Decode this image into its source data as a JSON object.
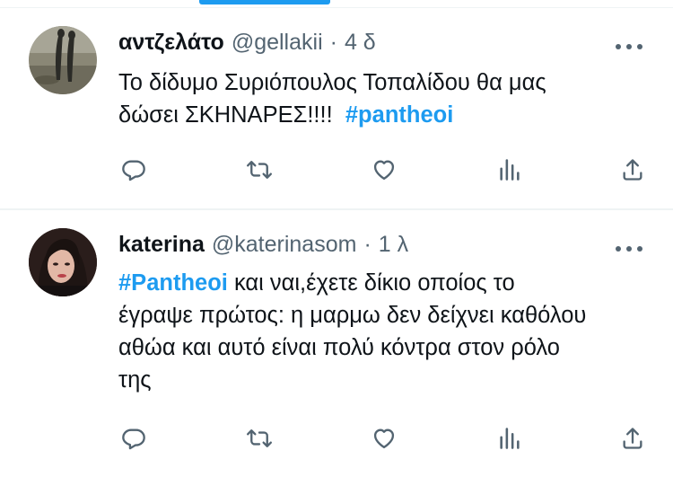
{
  "colors": {
    "accent": "#1d9bf0",
    "text": "#0f1419",
    "muted": "#536471",
    "divider": "#eff3f4"
  },
  "tweets": [
    {
      "author": "αντζελάτο",
      "handle": "@gellakii",
      "separator": "·",
      "time": "4 δ",
      "text_line1": "Το δίδυμο Συριόπουλος Τοπαλίδου θα μας",
      "text_line2_plain": "δώσει ΣΚΗΝΑΡΕΣ!!!!",
      "hashtag": "#pantheoi",
      "icons": [
        "reply-icon",
        "retweet-icon",
        "like-icon",
        "views-icon",
        "share-icon"
      ]
    },
    {
      "author": "katerina",
      "handle": "@katerinasom",
      "separator": "·",
      "time": "1 λ",
      "hashtag": "#Pantheoi",
      "text_line1_rest": " και ναι,έχετε δίκιο οποίος το",
      "text_line2": "έγραψε πρώτος: η μαρμω δεν δείχνει καθόλου",
      "text_line3": "αθώα και αυτό είναι πολύ κόντρα στον ρόλο",
      "text_line4": "της",
      "icons": [
        "reply-icon",
        "retweet-icon",
        "like-icon",
        "views-icon",
        "share-icon"
      ]
    }
  ]
}
